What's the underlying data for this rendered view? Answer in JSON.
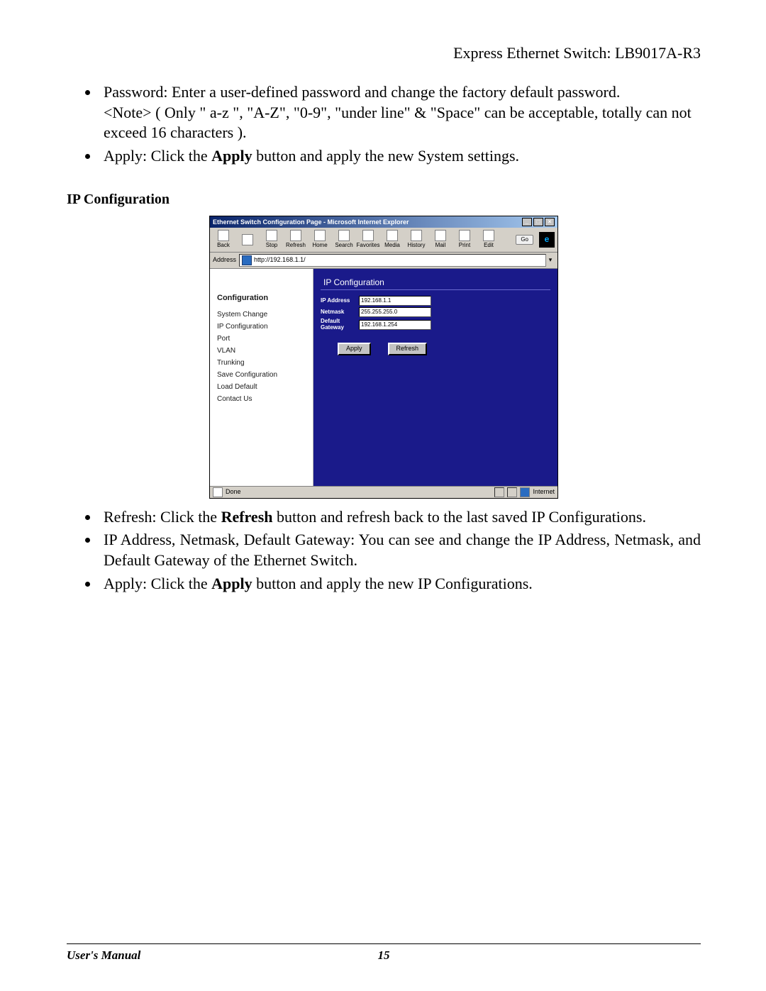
{
  "header": {
    "product": "Express Ethernet Switch: LB9017A-R3"
  },
  "bullets_top": [
    {
      "lead": "Password: ",
      "text": "Enter a user-defined password and change     the factory default password.",
      "note": "<Note> ( Only \" a-z \", \"A-Z\", \"0-9\", \"under line\" & \"Space\" can be acceptable, totally can not exceed 16 characters )."
    },
    {
      "before": "Apply: Click the ",
      "bold": "Apply",
      "after": " button and apply the new System settings."
    }
  ],
  "section_heading": "IP Configuration",
  "ie": {
    "title": "Ethernet Switch Configuration Page - Microsoft Internet Explorer",
    "toolbar": [
      "Back",
      "",
      "Stop",
      "Refresh",
      "Home",
      "Search",
      "Favorites",
      "Media",
      "History",
      "Mail",
      "Print",
      "Edit"
    ],
    "go_label": "Go",
    "address_label": "Address",
    "address_value": "http://192.168.1.1/",
    "sidebar": {
      "heading": "Configuration",
      "items": [
        "System Change",
        "IP Configuration",
        "Port",
        "VLAN",
        "Trunking",
        "Save Configuration",
        "Load Default",
        "Contact Us"
      ]
    },
    "panel": {
      "title": "IP Configuration",
      "fields": [
        {
          "label": "IP Address",
          "value": "192.168.1.1"
        },
        {
          "label": "Netmask",
          "value": "255.255.255.0"
        },
        {
          "label": "Default Gateway",
          "value": "192.168.1.254"
        }
      ],
      "buttons": [
        "Apply",
        "Refresh"
      ]
    },
    "status_left": "Done",
    "status_right": "Internet"
  },
  "bullets_bottom": [
    {
      "before": "Refresh: Click the ",
      "bold": "Refresh",
      "after": " button and refresh back to the last saved IP Configurations."
    },
    {
      "text": "IP Address, Netmask, Default Gateway: You can see and change the IP Address, Netmask, and Default Gateway of the Ethernet Switch."
    },
    {
      "before": "Apply: Click the ",
      "bold": "Apply",
      "after": " button and apply the new IP Configurations."
    }
  ],
  "footer": {
    "left": "User's Manual",
    "page": "15"
  }
}
